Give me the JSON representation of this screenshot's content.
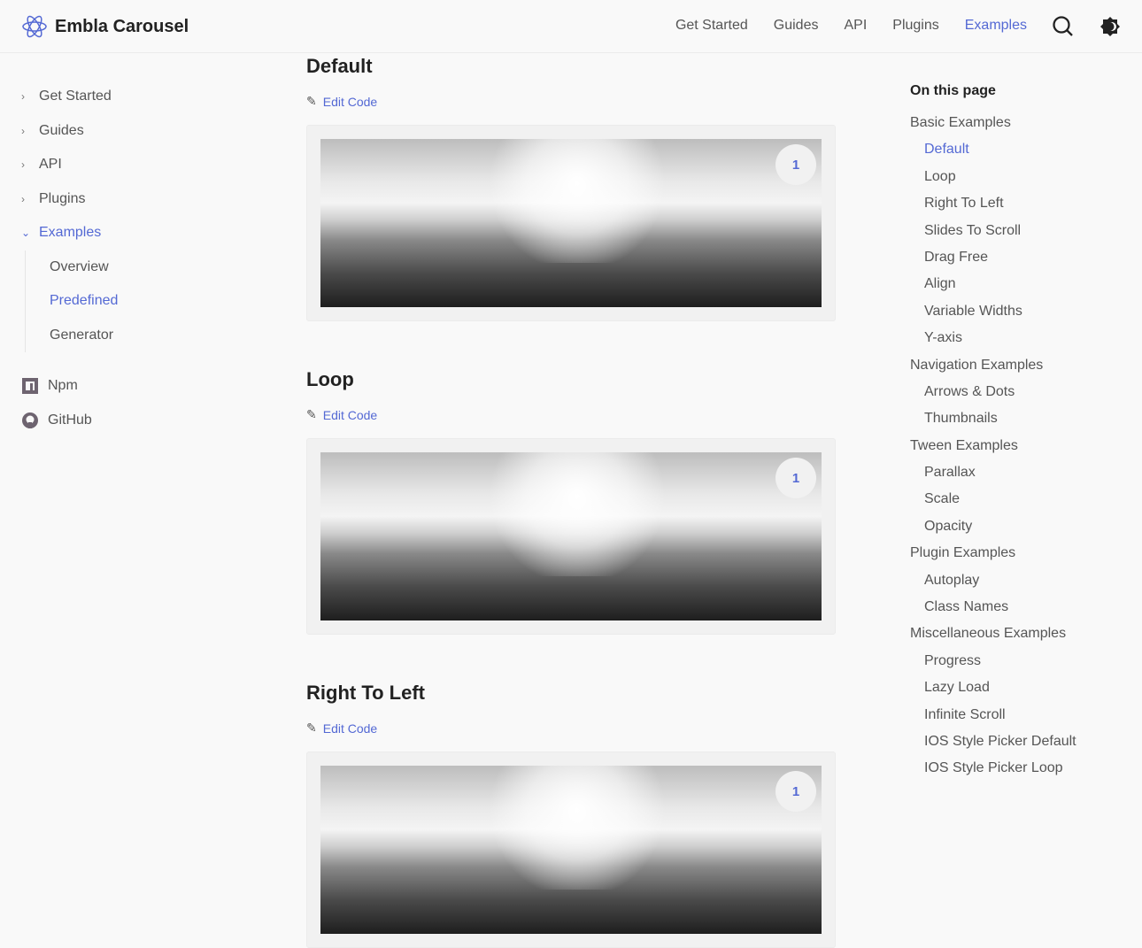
{
  "header": {
    "title": "Embla Carousel",
    "nav": [
      "Get Started",
      "Guides",
      "API",
      "Plugins",
      "Examples"
    ],
    "active": "Examples"
  },
  "sidebar": {
    "items": [
      "Get Started",
      "Guides",
      "API",
      "Plugins",
      "Examples"
    ],
    "sub": [
      "Overview",
      "Predefined",
      "Generator"
    ],
    "links": [
      "Npm",
      "GitHub"
    ]
  },
  "sections": [
    {
      "title": "Default",
      "edit": "Edit Code",
      "slide": "1"
    },
    {
      "title": "Loop",
      "edit": "Edit Code",
      "slide": "1"
    },
    {
      "title": "Right To Left",
      "edit": "Edit Code",
      "slide": "1"
    }
  ],
  "toc": {
    "title": "On this page",
    "items": [
      {
        "label": "Basic Examples",
        "indent": false
      },
      {
        "label": "Default",
        "indent": true,
        "active": true
      },
      {
        "label": "Loop",
        "indent": true
      },
      {
        "label": "Right To Left",
        "indent": true
      },
      {
        "label": "Slides To Scroll",
        "indent": true
      },
      {
        "label": "Drag Free",
        "indent": true
      },
      {
        "label": "Align",
        "indent": true
      },
      {
        "label": "Variable Widths",
        "indent": true
      },
      {
        "label": "Y-axis",
        "indent": true
      },
      {
        "label": "Navigation Examples",
        "indent": false
      },
      {
        "label": "Arrows & Dots",
        "indent": true
      },
      {
        "label": "Thumbnails",
        "indent": true
      },
      {
        "label": "Tween Examples",
        "indent": false
      },
      {
        "label": "Parallax",
        "indent": true
      },
      {
        "label": "Scale",
        "indent": true
      },
      {
        "label": "Opacity",
        "indent": true
      },
      {
        "label": "Plugin Examples",
        "indent": false
      },
      {
        "label": "Autoplay",
        "indent": true
      },
      {
        "label": "Class Names",
        "indent": true
      },
      {
        "label": "Miscellaneous Examples",
        "indent": false
      },
      {
        "label": "Progress",
        "indent": true
      },
      {
        "label": "Lazy Load",
        "indent": true
      },
      {
        "label": "Infinite Scroll",
        "indent": true
      },
      {
        "label": "IOS Style Picker Default",
        "indent": true
      },
      {
        "label": "IOS Style Picker Loop",
        "indent": true
      }
    ]
  },
  "colors": {
    "accent": "#5469d4",
    "background": "#f9f9f9"
  }
}
